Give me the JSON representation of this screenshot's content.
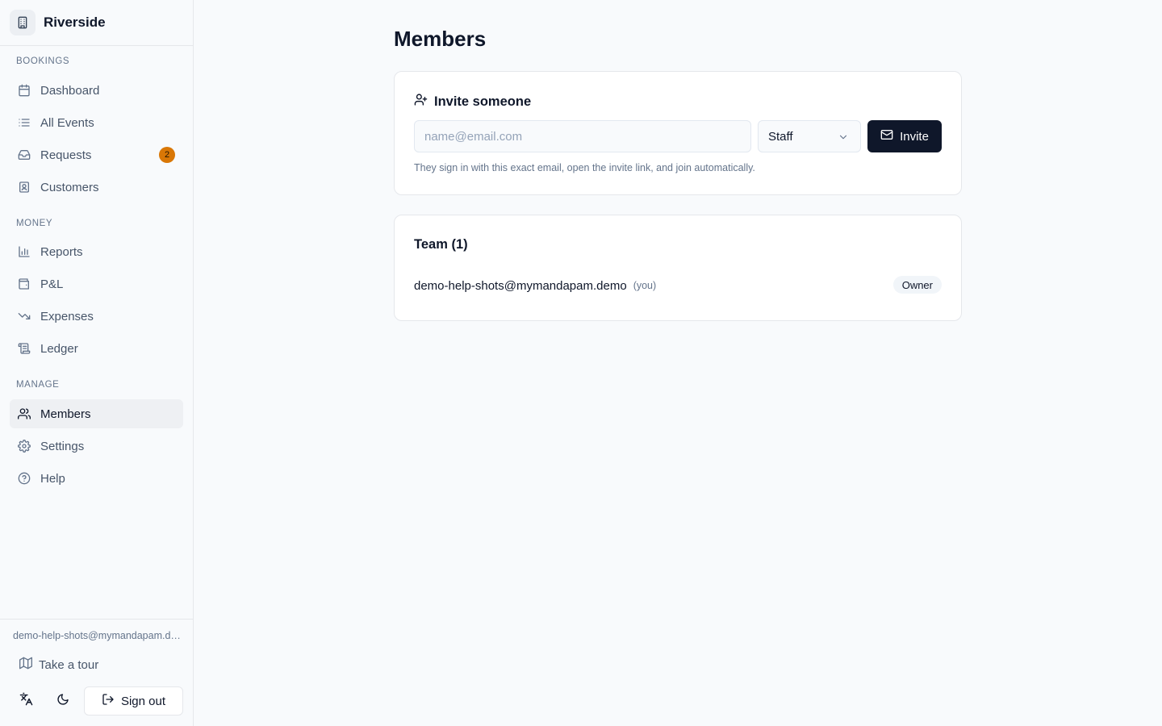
{
  "app": {
    "name": "Riverside"
  },
  "sidebar": {
    "sections": [
      {
        "label": "BOOKINGS"
      },
      {
        "label": "MONEY"
      },
      {
        "label": "MANAGE"
      }
    ],
    "items": [
      {
        "label": "Dashboard",
        "icon": "calendar-icon"
      },
      {
        "label": "All Events",
        "icon": "list-icon"
      },
      {
        "label": "Requests",
        "icon": "inbox-icon",
        "badge": "2"
      },
      {
        "label": "Customers",
        "icon": "contact-icon"
      },
      {
        "label": "Reports",
        "icon": "bar-chart-icon"
      },
      {
        "label": "P&L",
        "icon": "wallet-icon"
      },
      {
        "label": "Expenses",
        "icon": "trending-down-icon"
      },
      {
        "label": "Ledger",
        "icon": "scroll-icon"
      },
      {
        "label": "Members",
        "icon": "users-icon",
        "active": true
      },
      {
        "label": "Settings",
        "icon": "gear-icon"
      },
      {
        "label": "Help",
        "icon": "help-circle-icon"
      }
    ],
    "footer": {
      "email": "demo-help-shots@mymandapam.demo",
      "tour_label": "Take a tour",
      "sign_out_label": "Sign out"
    }
  },
  "main": {
    "title": "Members",
    "invite": {
      "title": "Invite someone",
      "email_placeholder": "name@email.com",
      "email_value": "",
      "role_selected": "Staff",
      "button_label": "Invite",
      "hint": "They sign in with this exact email, open the invite link, and join automatically."
    },
    "team": {
      "title": "Team (1)",
      "members": [
        {
          "email": "demo-help-shots@mymandapam.demo",
          "you_label": "(you)",
          "role": "Owner"
        }
      ]
    }
  },
  "colors": {
    "accent": "#0f172a",
    "badge": "#d97706",
    "active_bg": "#eef0f3"
  }
}
